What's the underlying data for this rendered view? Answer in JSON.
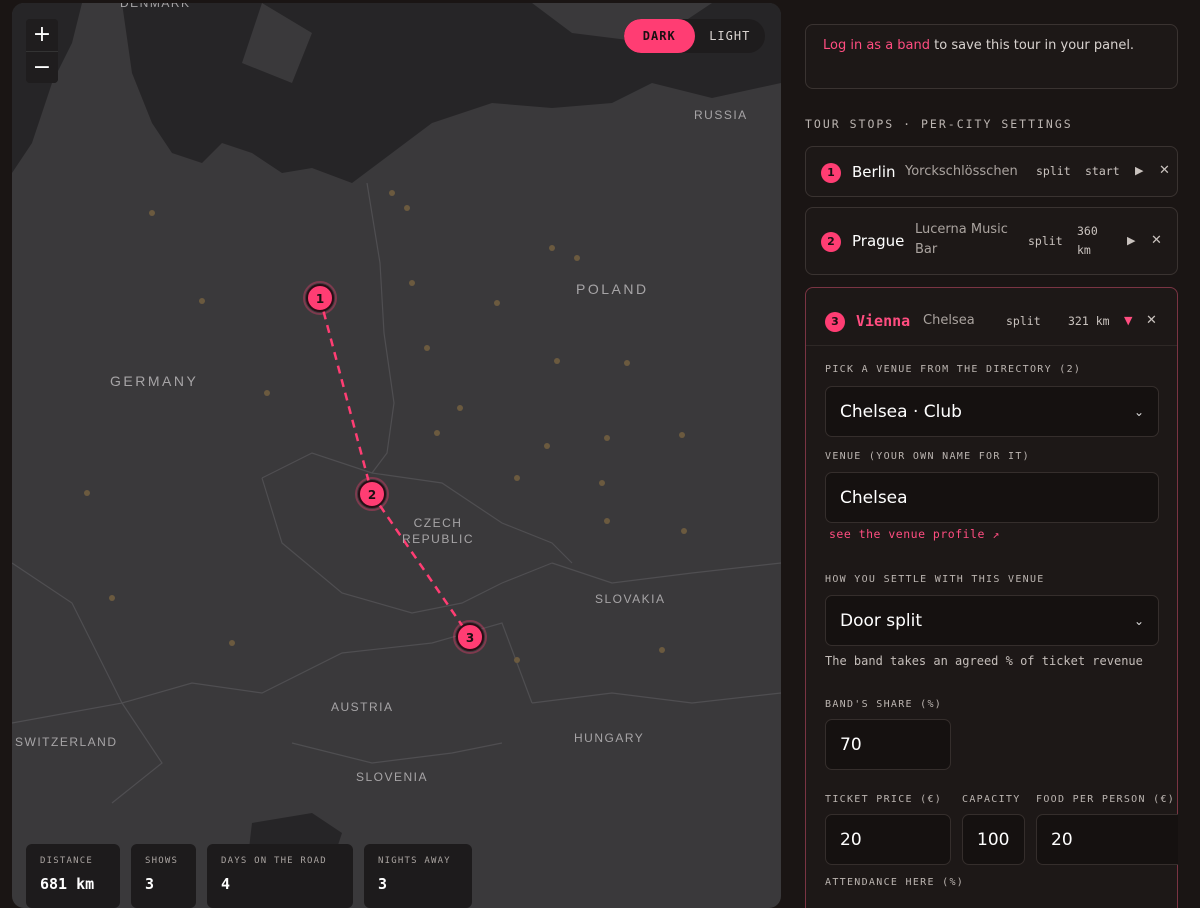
{
  "map": {
    "zoom_in_label": "+",
    "zoom_out_label": "−",
    "theme": {
      "dark_label": "DARK",
      "light_label": "LIGHT",
      "active": "dark"
    },
    "countries": {
      "denmark": "DENMARK",
      "russia": "RUSSIA",
      "poland": "POLAND",
      "germany": "GERMANY",
      "czech_line1": "CZECH",
      "czech_line2": "REPUBLIC",
      "slovakia": "SLOVAKIA",
      "austria": "AUSTRIA",
      "switzerland": "SWITZERLAND",
      "hungary": "HUNGARY",
      "slovenia": "SLOVENIA"
    },
    "markers": [
      "1",
      "2",
      "3"
    ],
    "route_color": "#ff3d73",
    "stats": [
      {
        "label": "DISTANCE",
        "value": "681 km"
      },
      {
        "label": "SHOWS",
        "value": "3"
      },
      {
        "label": "DAYS ON THE ROAD",
        "value": "4"
      },
      {
        "label": "NIGHTS AWAY",
        "value": "3"
      }
    ]
  },
  "panel": {
    "login": {
      "link_text": "Log in as a band",
      "rest": " to save this tour in your panel."
    },
    "section_title": "TOUR STOPS · PER-CITY SETTINGS",
    "stops": [
      {
        "num": "1",
        "city": "Berlin",
        "venue": "Yorckschlösschen",
        "deal": "split",
        "distance": "start"
      },
      {
        "num": "2",
        "city": "Prague",
        "venue_line1": "Lucerna Music",
        "venue_line2": "Bar",
        "deal": "split",
        "distance_line1": "360",
        "distance_line2": "km"
      },
      {
        "num": "3",
        "city": "Vienna",
        "venue": "Chelsea",
        "deal": "split",
        "distance": "321 km"
      }
    ],
    "active_stop": {
      "pick_label": "PICK A VENUE FROM THE DIRECTORY (2)",
      "pick_value": "Chelsea · Club",
      "venue_label": "VENUE (YOUR OWN NAME FOR IT)",
      "venue_value": "Chelsea",
      "profile_link": "see the venue profile ↗",
      "settle_label": "HOW YOU SETTLE WITH THIS VENUE",
      "settle_value": "Door split",
      "settle_help": "The band takes an agreed % of ticket revenue",
      "share_label": "BAND'S SHARE (%)",
      "share_value": "70",
      "ticket_label": "TICKET PRICE (€)",
      "ticket_value": "20",
      "capacity_label": "CAPACITY",
      "capacity_value": "100",
      "food_label": "FOOD PER PERSON (€)",
      "food_value": "20",
      "attendance_label": "ATTENDANCE HERE (%)"
    }
  }
}
